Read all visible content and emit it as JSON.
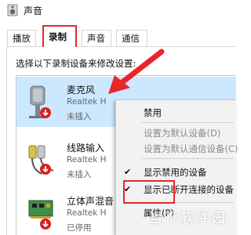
{
  "window": {
    "title": "声音"
  },
  "tabs": [
    {
      "label": "播放"
    },
    {
      "label": "录制"
    },
    {
      "label": "声音"
    },
    {
      "label": "通信"
    }
  ],
  "instruction": "选择以下录制设备来修改设置:",
  "devices": [
    {
      "name": "麦克风",
      "sub": "Realtek H",
      "status": "未插入"
    },
    {
      "name": "线路输入",
      "sub": "Realtek H",
      "status": "未插入"
    },
    {
      "name": "立体声混音",
      "sub": "Realtek H",
      "status": "已停用"
    }
  ],
  "context_menu": {
    "items": [
      {
        "label": "禁用",
        "disabled": false,
        "checked": false
      },
      {
        "label": "设置为默认设备(D)",
        "disabled": true,
        "checked": false
      },
      {
        "label": "设置为默认通信设备(C)",
        "disabled": true,
        "checked": false
      },
      {
        "label": "显示禁用的设备",
        "disabled": false,
        "checked": true
      },
      {
        "label": "显示已断开连接的设备",
        "disabled": false,
        "checked": true
      },
      {
        "label": "属性(P)",
        "disabled": false,
        "checked": false
      }
    ]
  },
  "colors": {
    "annotation_red": "#e8262a",
    "selection_blue": "#cce8ff"
  },
  "watermark": {
    "text": "当下软件园"
  }
}
